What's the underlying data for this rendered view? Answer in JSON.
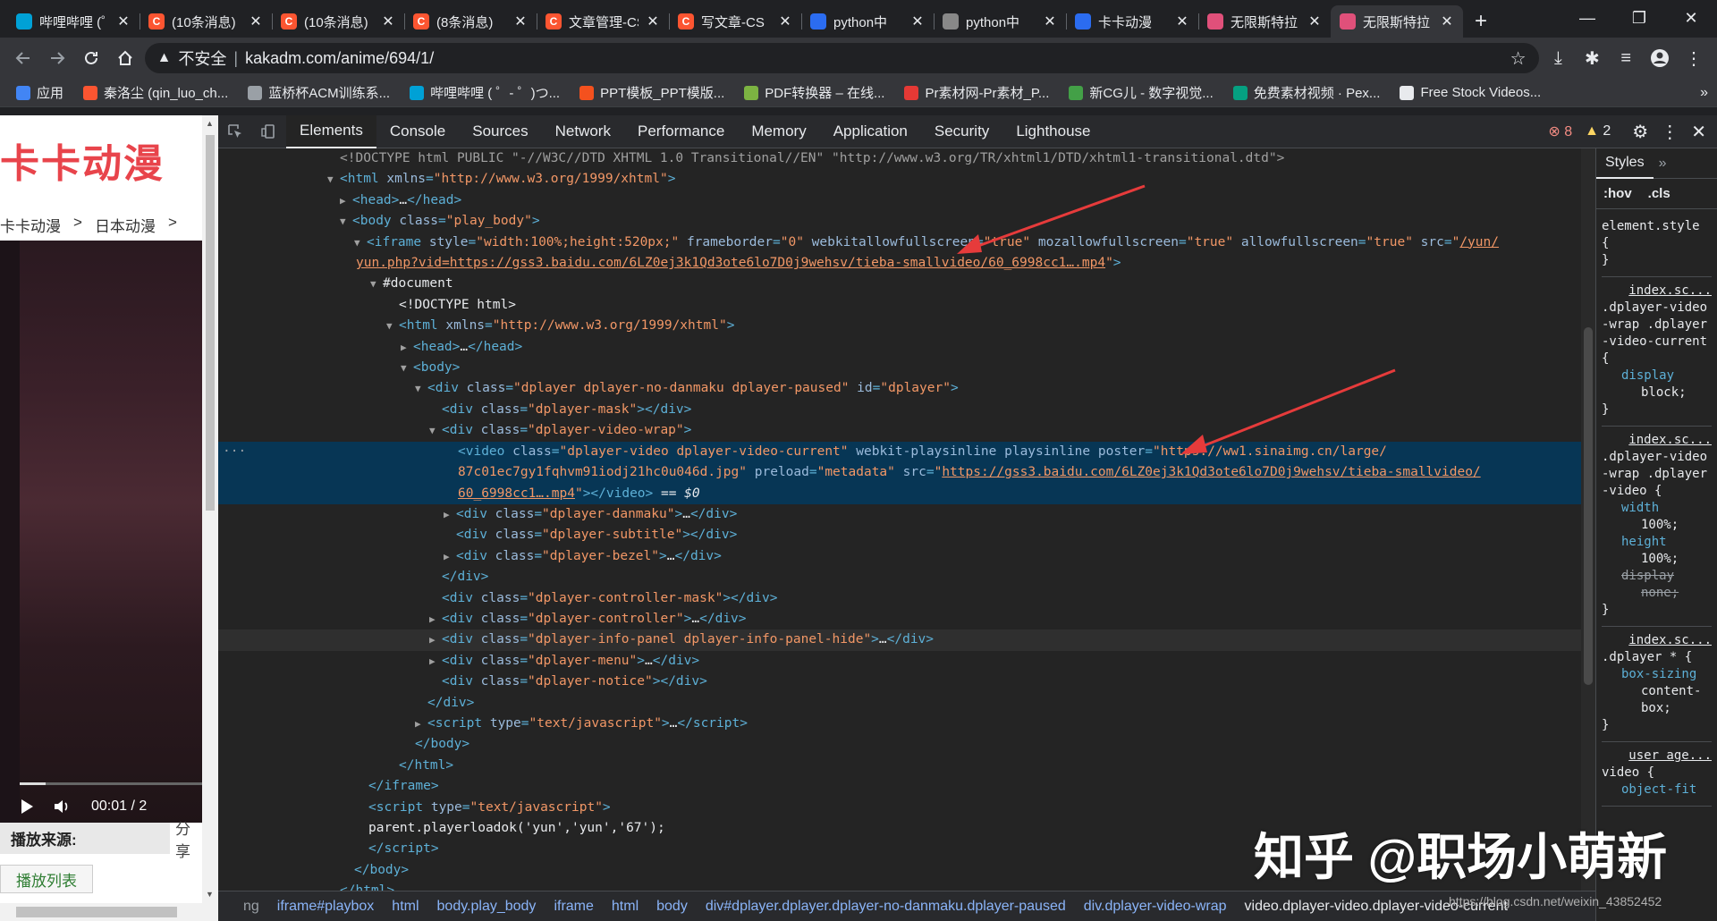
{
  "browser": {
    "tabs": [
      {
        "title": "哔哩哔哩 (゜-゜)つ",
        "favicon_color": "#00a1d6",
        "favicon_glyph": "tv-icon",
        "active": false
      },
      {
        "title": "(10条消息)",
        "favicon_color": "#fc5531",
        "favicon_glyph": "C",
        "active": false
      },
      {
        "title": "(10条消息)",
        "favicon_color": "#fc5531",
        "favicon_glyph": "C",
        "active": false
      },
      {
        "title": "(8条消息)",
        "favicon_color": "#fc5531",
        "favicon_glyph": "C",
        "active": false
      },
      {
        "title": "文章管理-CS",
        "favicon_color": "#fc5531",
        "favicon_glyph": "C",
        "active": false
      },
      {
        "title": "写文章-CS",
        "favicon_color": "#fc5531",
        "favicon_glyph": "C",
        "active": false
      },
      {
        "title": "python中",
        "favicon_color": "#2b6cf0",
        "favicon_glyph": "bing-icon",
        "active": false
      },
      {
        "title": "python中",
        "favicon_color": "#888888",
        "favicon_glyph": "wolfram-icon",
        "active": false
      },
      {
        "title": "卡卡动漫",
        "favicon_color": "#2b6cf0",
        "favicon_glyph": "bing-icon",
        "active": false
      },
      {
        "title": "无限斯特拉",
        "favicon_color": "#e0507a",
        "favicon_glyph": "flower-icon",
        "active": false
      },
      {
        "title": "无限斯特拉",
        "favicon_color": "#e0507a",
        "favicon_glyph": "flower-icon",
        "active": true
      }
    ],
    "new_tab_label": "+",
    "window_controls": {
      "minimize": "—",
      "maximize": "❐",
      "close": "✕"
    },
    "toolbar": {
      "security_label": "不安全",
      "url": "kakadm.com/anime/694/1/"
    },
    "bookmarks": [
      {
        "label": "应用",
        "color": "#4285f4"
      },
      {
        "label": "秦洛尘 (qin_luo_ch...",
        "color": "#fc5531"
      },
      {
        "label": "蓝桥杯ACM训练系...",
        "color": "#9aa0a6"
      },
      {
        "label": "哔哩哔哩 ( ゜- ゜)つ...",
        "color": "#00a1d6"
      },
      {
        "label": "PPT模板_PPT模版...",
        "color": "#f4511e"
      },
      {
        "label": "PDF转换器 – 在线...",
        "color": "#7cb342"
      },
      {
        "label": "Pr素材网-Pr素材_P...",
        "color": "#e53935"
      },
      {
        "label": "新CG儿 - 数字视觉...",
        "color": "#43a047"
      },
      {
        "label": "免费素材视频 · Pex...",
        "color": "#05a081"
      },
      {
        "label": "Free Stock Videos...",
        "color": "#e8eaed"
      }
    ],
    "bookmarks_more": "»"
  },
  "page": {
    "brand": "卡卡动漫",
    "breadcrumb": [
      "卡卡动漫",
      ">",
      "日本动漫",
      ">"
    ],
    "player_time": "00:01 / 2",
    "progress": 0.14,
    "source_label": "播放来源:",
    "share_label": "分享",
    "playlist_label": "播放列表"
  },
  "devtools": {
    "tabs": [
      "Elements",
      "Console",
      "Sources",
      "Network",
      "Performance",
      "Memory",
      "Application",
      "Security",
      "Lighthouse"
    ],
    "error_count": "8",
    "warning_count": "2",
    "styles_tab": "Styles",
    "styles_more": "»",
    "filter_hov": ":hov",
    "filter_cls": ".cls",
    "styles_rules": [
      {
        "src": "",
        "selector": "element.style {",
        "props": [],
        "end": "}"
      },
      {
        "src": "index.sc...",
        "selector": ".dplayer-video-wrap .dplayer-video-current {",
        "props": [
          {
            "p": "display",
            "v": "block;",
            "strike": false
          }
        ],
        "end": "}"
      },
      {
        "src": "index.sc...",
        "selector": ".dplayer-video-wrap .dplayer-video {",
        "props": [
          {
            "p": "width",
            "v": "100%;",
            "strike": false
          },
          {
            "p": "height",
            "v": "100%;",
            "strike": false
          },
          {
            "p": "display",
            "v": "none;",
            "strike": true
          }
        ],
        "end": "}"
      },
      {
        "src": "index.sc...",
        "selector": ".dplayer * {",
        "props": [
          {
            "p": "box-sizing",
            "v": "content-box;",
            "strike": false
          }
        ],
        "end": "}"
      },
      {
        "src": "user age...",
        "selector": "video {",
        "props": [
          {
            "p": "object-fit",
            "v": "",
            "strike": false
          }
        ],
        "end": ""
      }
    ],
    "breadcrumbs": [
      "ng",
      "iframe#playbox",
      "html",
      "body.play_body",
      "iframe",
      "html",
      "body",
      "div#dplayer.dplayer.dplayer-no-danmaku.dplayer-paused",
      "div.dplayer-video-wrap",
      "video.dplayer-video.dplayer-video-current"
    ],
    "dom": {
      "l1": "<!DOCTYPE html PUBLIC \"-//W3C//DTD XHTML 1.0 Transitional//EN\" \"http://www.w3.org/TR/xhtml1/DTD/xhtml1-transitional.dtd\">",
      "html_xmlns": "http://www.w3.org/1999/xhtml",
      "body_class": "play_body",
      "iframe_style": "width:100%;height:520px;",
      "iframe_frameborder": "0",
      "iframe_webkitallowfullscreen": "true",
      "iframe_mozallowfullscreen": "true",
      "iframe_allowfullscreen": "true",
      "iframe_src_1": "/yun/",
      "iframe_src_2": "yun.php?vid=https://gss3.baidu.com/6LZ0ej3k1Qd3ote6lo7D0j9wehsv/tieba-smallvideo/60_6998cc1….mp4",
      "document": "#document",
      "doctype2": "<!DOCTYPE html>",
      "dplayer_class": "dplayer dplayer-no-danmaku dplayer-paused",
      "dplayer_id": "dplayer",
      "mask_class": "dplayer-mask",
      "wrap_class": "dplayer-video-wrap",
      "video_class": "dplayer-video dplayer-video-current",
      "video_poster_1": "https://ww1.sinaimg.cn/large/",
      "video_poster_2": "87c01ec7gy1fqhvm91iodj21hc0u046d.jpg",
      "video_preload": "metadata",
      "video_src_1": "https://gss3.baidu.com/6LZ0ej3k1Qd3ote6lo7D0j9wehsv/tieba-smallvideo/",
      "video_src_2": "60_6998cc1….mp4",
      "sel_marker": " == $0",
      "danmaku_class": "dplayer-danmaku",
      "subtitle_class": "dplayer-subtitle",
      "bezel_class": "dplayer-bezel",
      "controller_mask_class": "dplayer-controller-mask",
      "controller_class": "dplayer-controller",
      "info_panel_class": "dplayer-info-panel dplayer-info-panel-hide",
      "menu_class": "dplayer-menu",
      "notice_class": "dplayer-notice",
      "script_type": "text/javascript",
      "script_code": "parent.playerloadok('yun','yun','67');",
      "ellipsis": "…",
      "dots": "···"
    }
  },
  "watermark": "知乎 @职场小萌新",
  "watermark_small": "https://blog.csdn.net/weixin_43852452"
}
